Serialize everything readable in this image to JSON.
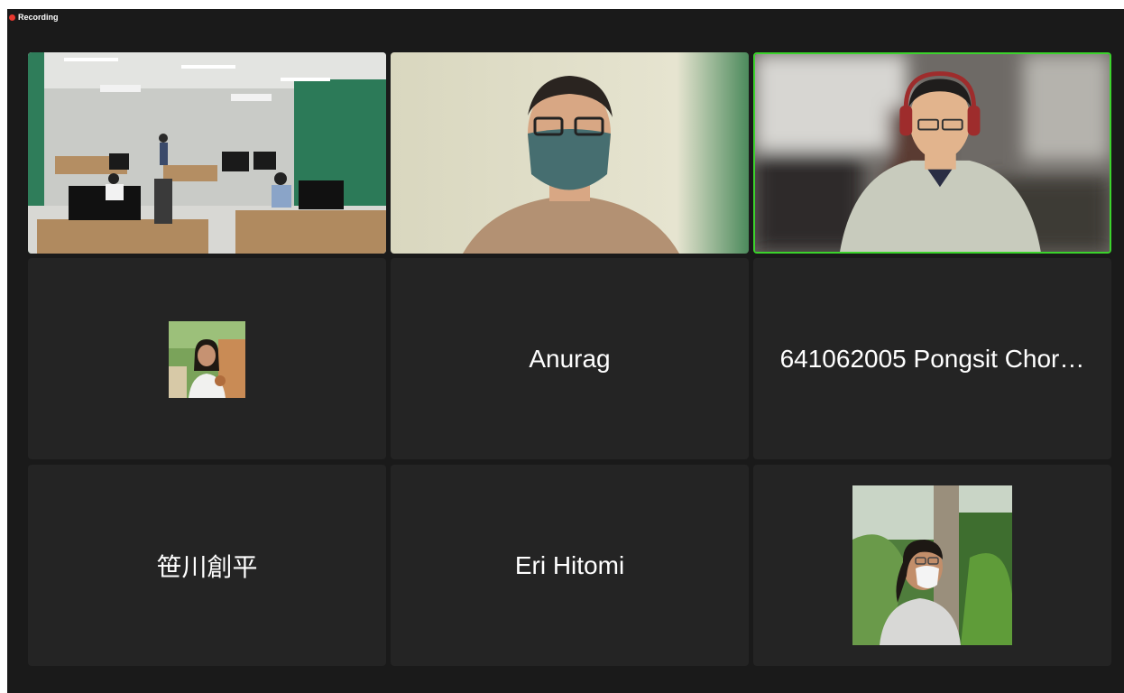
{
  "recording": {
    "label": "Recording"
  },
  "participants": [
    {
      "kind": "video",
      "scene": "classroom"
    },
    {
      "kind": "video",
      "scene": "man-with-mask"
    },
    {
      "kind": "video",
      "scene": "man-with-headphones",
      "active_speaker": true
    },
    {
      "kind": "avatar",
      "scene": "girl-in-garden"
    },
    {
      "kind": "name",
      "name": "Anurag"
    },
    {
      "kind": "name",
      "name": "641062005 Pongsit Chor…"
    },
    {
      "kind": "name",
      "name": "笹川創平"
    },
    {
      "kind": "name",
      "name": "Eri Hitomi"
    },
    {
      "kind": "avatar",
      "scene": "woman-with-mask-among-plants"
    }
  ],
  "colors": {
    "background": "#1a1a1a",
    "tile": "#242424",
    "active_speaker_border": "#3bd32c",
    "recording_dot": "#e8382f"
  }
}
